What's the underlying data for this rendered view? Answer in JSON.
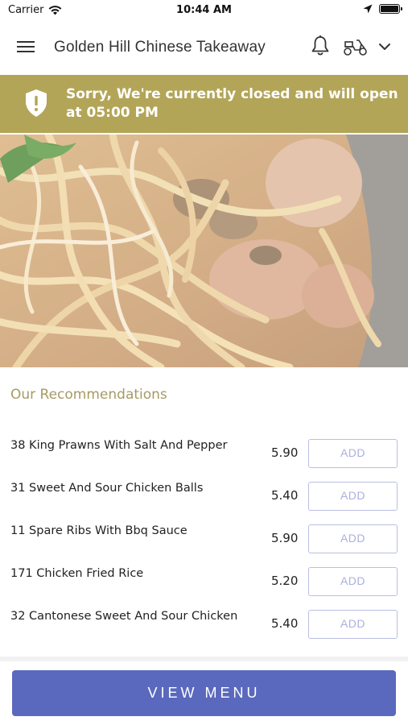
{
  "status_bar": {
    "carrier": "Carrier",
    "time": "10:44 AM",
    "icons": [
      "wifi-icon",
      "location-arrow-icon",
      "battery-icon"
    ]
  },
  "header": {
    "title": "Golden Hill Chinese Takeaway",
    "icons": [
      "hamburger-menu-icon",
      "bell-icon",
      "scooter-icon",
      "chevron-down-icon"
    ]
  },
  "closed_banner": {
    "message": "Sorry, We're currently closed and will open at 05:00 PM",
    "icon": "shield-alert-icon",
    "color": "#b3a558"
  },
  "hero": {
    "subject": "noodles-chicken-mushroom-photo"
  },
  "recommendations": {
    "heading": "Our Recommendations",
    "add_label": "ADD",
    "items": [
      {
        "name": "38 King Prawns With Salt And Pepper",
        "price": "5.90"
      },
      {
        "name": "31 Sweet And Sour Chicken Balls",
        "price": "5.40"
      },
      {
        "name": "11 Spare Ribs With Bbq Sauce",
        "price": "5.90"
      },
      {
        "name": "171 Chicken Fried Rice",
        "price": "5.20"
      },
      {
        "name": "32 Cantonese Sweet And Sour Chicken",
        "price": "5.40"
      }
    ]
  },
  "footer": {
    "view_menu_label": "VIEW MENU",
    "button_color": "#5a69bd"
  }
}
